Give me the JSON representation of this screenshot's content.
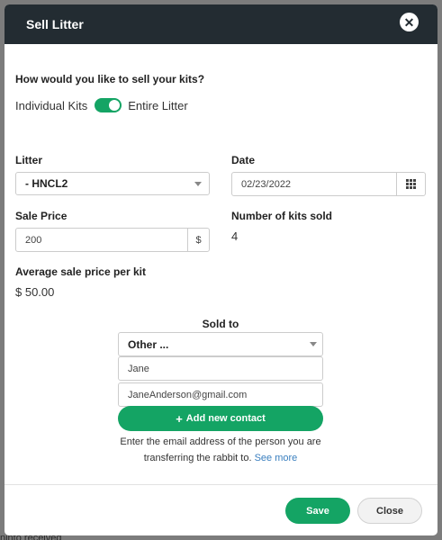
{
  "background": {
    "partial_text": "ninto received"
  },
  "modal": {
    "title": "Sell Litter",
    "close_icon": "close-icon"
  },
  "sell_question": "How would you like to sell your kits?",
  "toggle": {
    "left_label": "Individual Kits",
    "right_label": "Entire Litter",
    "state": "on",
    "color": "#14a464"
  },
  "litter": {
    "label": "Litter",
    "value": "- HNCL2"
  },
  "date": {
    "label": "Date",
    "value": "02/23/2022",
    "icon": "calendar-grid-icon"
  },
  "sale_price": {
    "label": "Sale Price",
    "value": "200",
    "unit": "$"
  },
  "kits_sold": {
    "label": "Number of kits sold",
    "value": "4"
  },
  "avg_price": {
    "label": "Average sale price per kit",
    "value": "$ 50.00"
  },
  "sold_to": {
    "label": "Sold to",
    "selected": "Other ...",
    "name_value": "Jane",
    "email_value": "JaneAnderson@gmail.com",
    "add_contact_label": "Add new contact",
    "help_text_line1": "Enter the email address of the person you are",
    "help_text_line2": "transferring the rabbit to.",
    "see_more": "See more"
  },
  "footer": {
    "save_label": "Save",
    "close_label": "Close"
  },
  "colors": {
    "header": "#232c32",
    "accent": "#14a464",
    "link": "#3a7fbf"
  }
}
